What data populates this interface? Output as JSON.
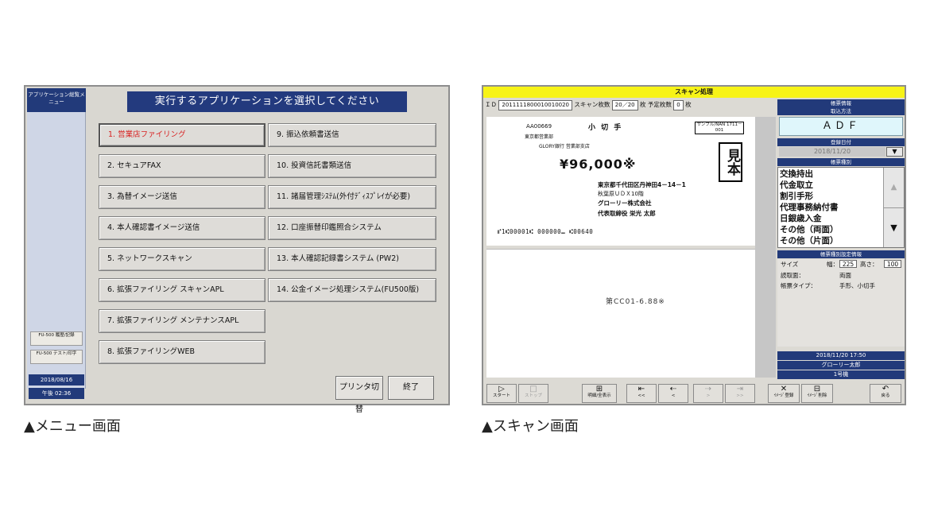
{
  "menu_screen": {
    "side_title": "アプリケーション総覧メニュー",
    "side_buttons": [
      "FU-500 履歴/記録",
      "FU-500 テスト/印字"
    ],
    "date": "2018/08/16",
    "time": "午後 02:36",
    "header": "実行するアプリケーションを選択してください",
    "left_items": [
      "1. 営業店ファイリング",
      "2. セキュアFAX",
      "3. 為替イメージ送信",
      "4. 本人確認書イメージ送信",
      "5. ネットワークスキャン",
      "6. 拡張ファイリング スキャンAPL",
      "7. 拡張ファイリング メンテナンスAPL",
      "8. 拡張ファイリングWEB"
    ],
    "right_items": [
      "9. 振込依頼書送信",
      "10. 投資信託書類送信",
      "11. 諸届管理ｼｽﾃﾑ(外付ﾃﾞｨｽﾌﾟﾚｲが必要)",
      "12. 口座振替印鑑照合システム",
      "13. 本人確認記録書システム (PW2)",
      "14. 公金イメージ処理システム(FU500版)"
    ],
    "printer_button": "プリンタ切替",
    "exit_button": "終了"
  },
  "scan_screen": {
    "title": "スキャン処理",
    "id_label": "ＩＤ",
    "id_value": "2011111800010010020",
    "count_label": "スキャン枚数",
    "count_value": "20／20",
    "count_unit": "枚",
    "planned_label": "予定枚数",
    "planned_value": "0",
    "planned_unit": "枚",
    "check": {
      "number": "AA00669",
      "kind": "小 切 手",
      "sample_tag": "サンプル/NAN 1711－001",
      "stamp": "見本",
      "bank_line1": "東京都営業部",
      "bank_line2": "GLORY銀行 営業部支店",
      "amount": "¥96,000※",
      "payee_addr1": "東京都千代田区丹神田4－14－1",
      "payee_addr2": "秋葉原ＵＤＸ10階",
      "payee_company": "グローリー株式会社",
      "payee_name": "代表取締役 栄光 太郎",
      "micr": "⑈1⑆00001⑆ 000000⑉ ⑆00640",
      "page2_text": "第CC01-6.88※"
    },
    "panel": {
      "head1": "帳票情報",
      "head2": "取込方法",
      "method": "ＡＤＦ",
      "head3": "登録日付",
      "reg_date": "2018/11/20",
      "head4": "帳票種別",
      "types": [
        "交換持出",
        "代金取立",
        "割引手形",
        "代理事務納付書",
        "日銀歳入金",
        "その他（両面）",
        "その他（片面）"
      ],
      "head5": "帳票種別設定情報",
      "size_label": "サイズ",
      "width_label": "幅：",
      "width_value": "225",
      "height_label": "高さ：",
      "height_value": "100",
      "read_label": "読取面：",
      "read_value": "両面",
      "type_label": "帳票タイプ：",
      "type_value": "手形、小切手",
      "datetime": "2018/11/20 17:50",
      "user": "グローリー太郎",
      "machine": "1号機"
    },
    "toolbar": [
      {
        "num": "1",
        "icon": "▷",
        "label": "スタート"
      },
      {
        "num": "2",
        "icon": "□",
        "label": "ストップ"
      },
      {
        "num": "4",
        "icon": "⊞",
        "label": "明細/全表示"
      },
      {
        "num": "5",
        "icon": "⇤",
        "label": "<<"
      },
      {
        "num": "6",
        "icon": "⇠",
        "label": "<"
      },
      {
        "num": "7",
        "icon": "⇢",
        "label": ">"
      },
      {
        "num": "8",
        "icon": "⇥",
        "label": ">>"
      },
      {
        "num": "9",
        "icon": "✕",
        "label": "ｲﾒｰｼﾞ登録"
      },
      {
        "num": "10",
        "icon": "⊟",
        "label": "ｲﾒｰｼﾞ削除"
      },
      {
        "num": "12",
        "icon": "↶",
        "label": "戻る"
      }
    ]
  },
  "captions": {
    "menu": "▲メニュー画面",
    "scan": "▲スキャン画面"
  }
}
